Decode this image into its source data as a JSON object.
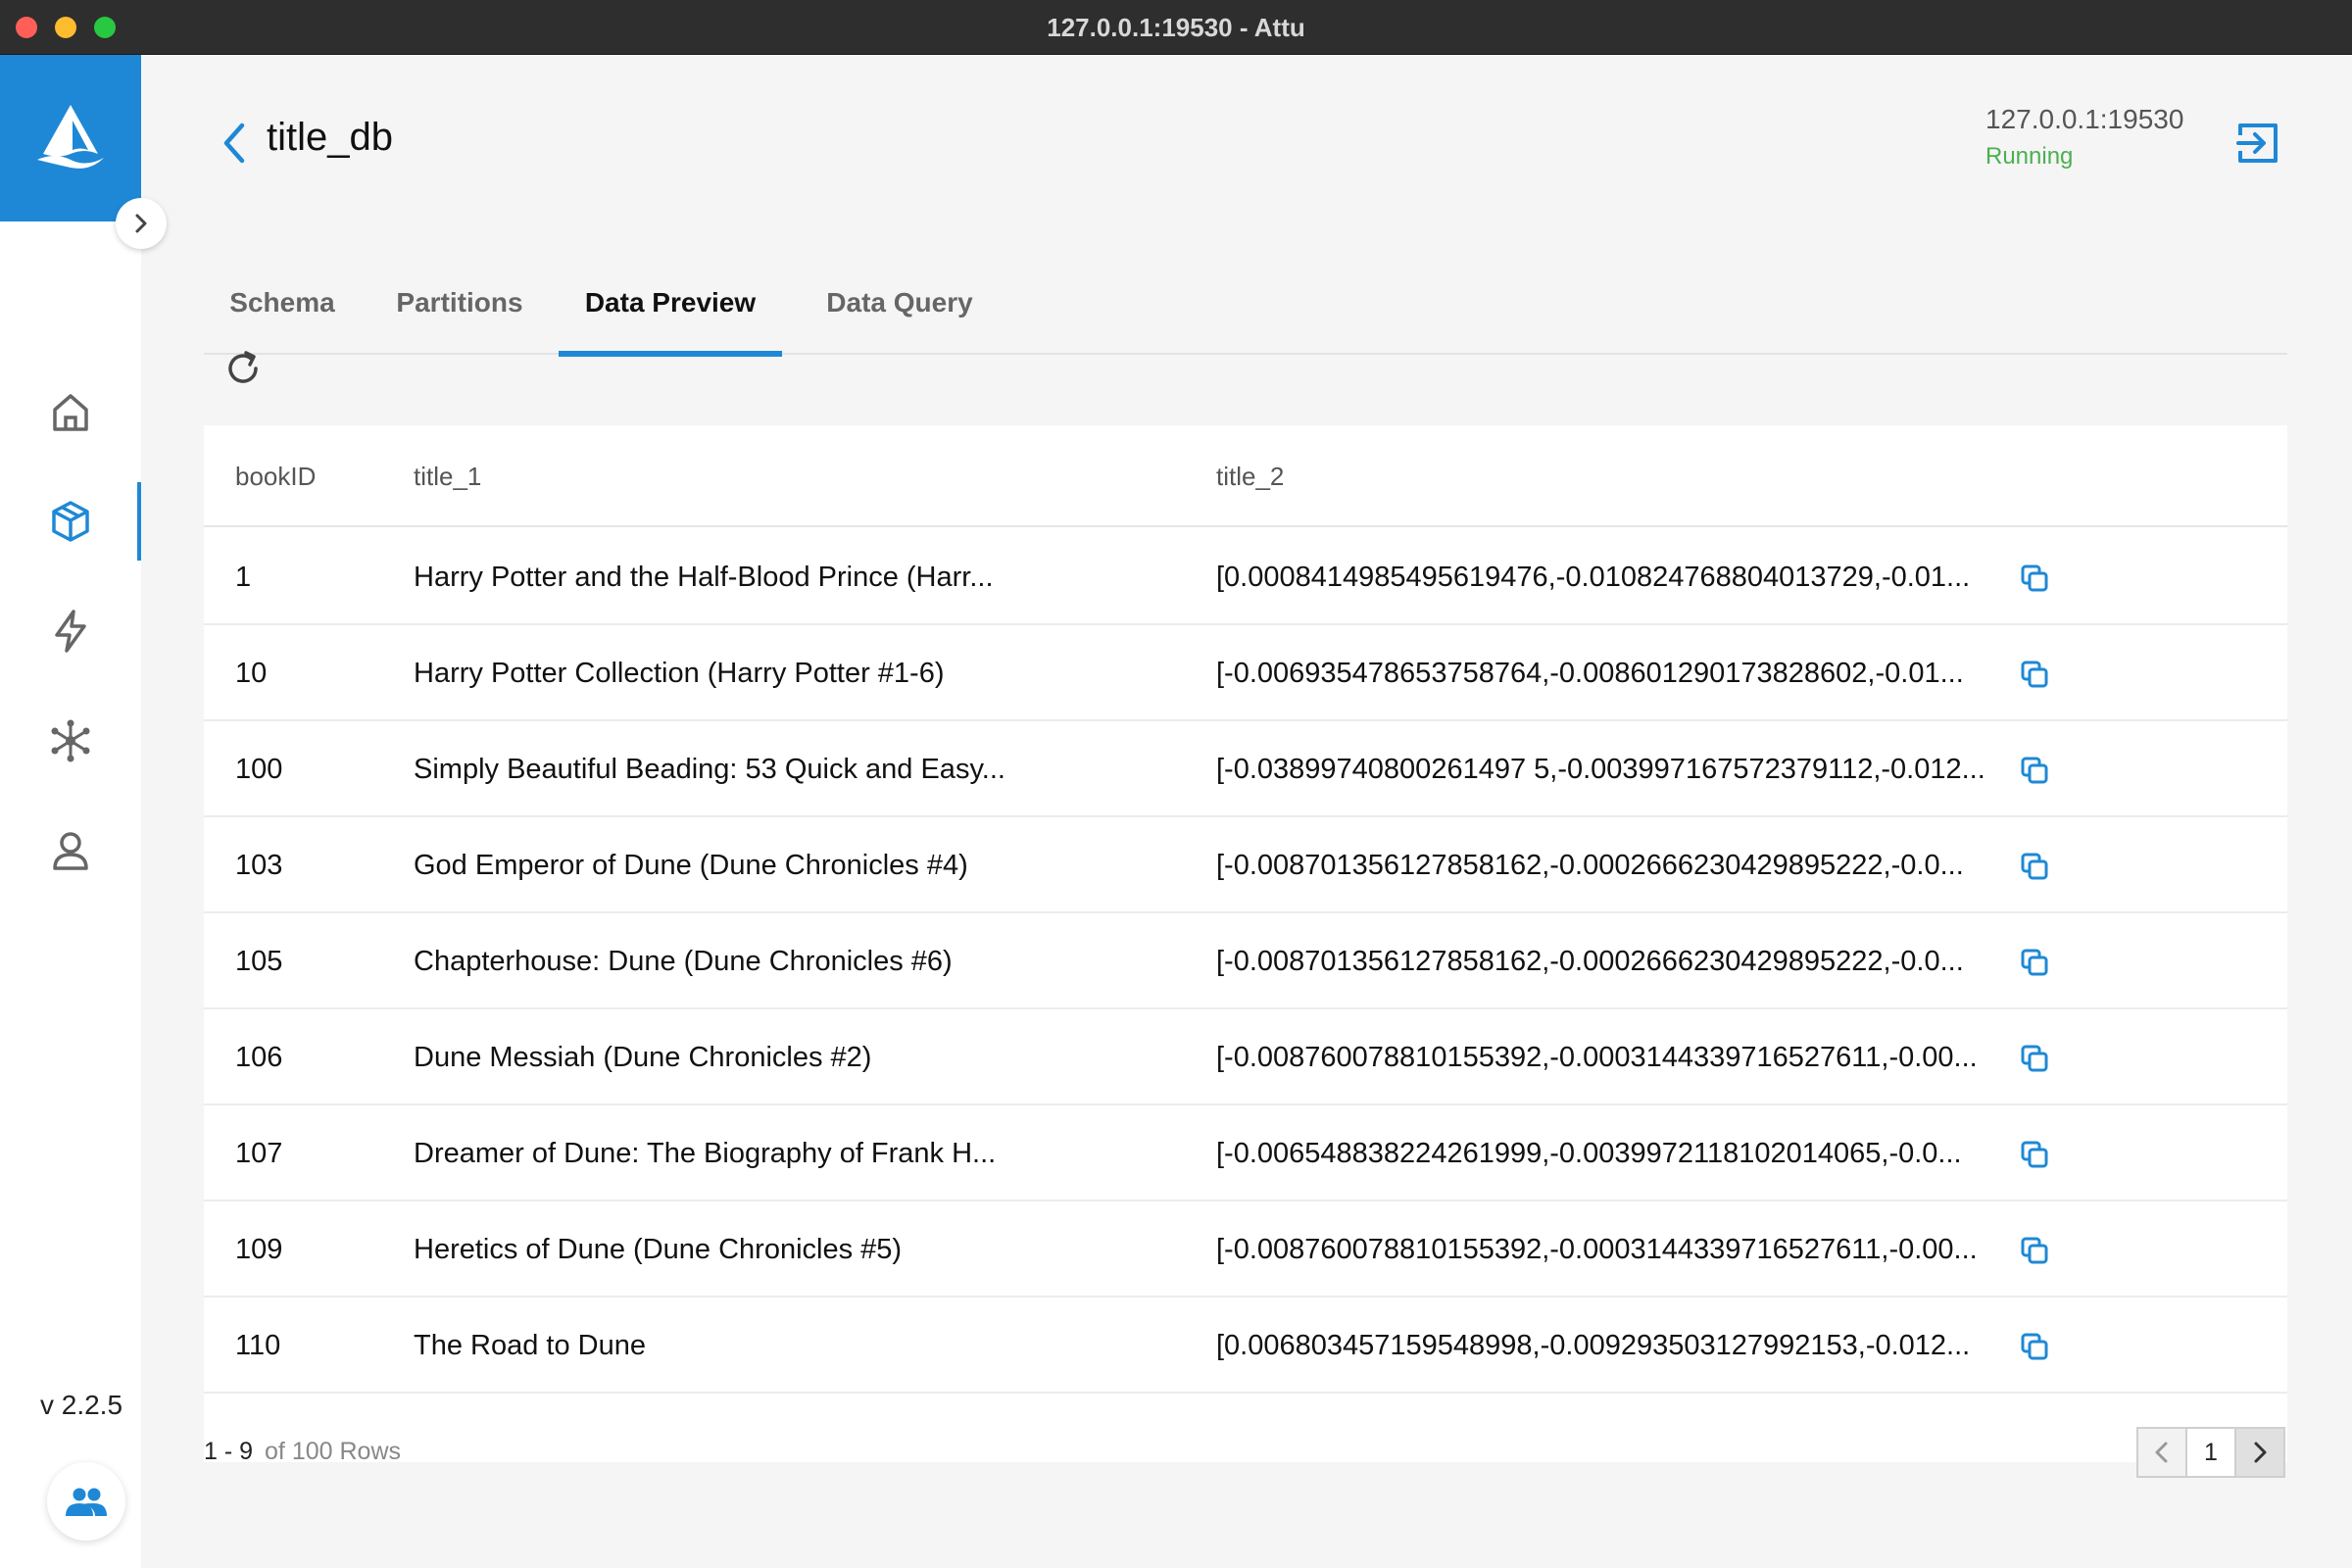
{
  "window": {
    "title": "127.0.0.1:19530 - Attu"
  },
  "sidebar": {
    "version": "v 2.2.5",
    "nav": [
      {
        "id": "home",
        "icon": "home-icon"
      },
      {
        "id": "collections",
        "icon": "cube-icon",
        "active": true
      },
      {
        "id": "search",
        "icon": "lightning-icon"
      },
      {
        "id": "system",
        "icon": "network-icon"
      },
      {
        "id": "users",
        "icon": "user-icon"
      }
    ]
  },
  "header": {
    "title": "title_db",
    "connection": {
      "address": "127.0.0.1:19530",
      "status": "Running"
    }
  },
  "tabs": [
    {
      "label": "Schema"
    },
    {
      "label": "Partitions"
    },
    {
      "label": "Data Preview",
      "active": true
    },
    {
      "label": "Data Query"
    }
  ],
  "table": {
    "columns": [
      "bookID",
      "title_1",
      "title_2"
    ],
    "rows": [
      {
        "bookID": "1",
        "title_1": "Harry Potter and the Half-Blood Prince (Harr...",
        "title_2": "[0.0008414985495619476,-0.010824768804013729,-0.01..."
      },
      {
        "bookID": "10",
        "title_1": "Harry Potter Collection (Harry Potter #1-6)",
        "title_2": "[-0.006935478653758764,-0.008601290173828602,-0.01..."
      },
      {
        "bookID": "100",
        "title_1": "Simply Beautiful Beading: 53 Quick and Easy...",
        "title_2": "[-0.03899740800261497 5,-0.003997167572379112,-0.012..."
      },
      {
        "bookID": "103",
        "title_1": "God Emperor of Dune (Dune Chronicles #4)",
        "title_2": "[-0.008701356127858162,-0.0002666230429895222,-0.0..."
      },
      {
        "bookID": "105",
        "title_1": "Chapterhouse: Dune (Dune Chronicles #6)",
        "title_2": "[-0.008701356127858162,-0.0002666230429895222,-0.0..."
      },
      {
        "bookID": "106",
        "title_1": "Dune Messiah (Dune Chronicles #2)",
        "title_2": "[-0.008760078810155392,-0.0003144339716527611,-0.00..."
      },
      {
        "bookID": "107",
        "title_1": "Dreamer of Dune: The Biography of Frank H...",
        "title_2": "[-0.006548838224261999,-0.0039972118102014065,-0.0..."
      },
      {
        "bookID": "109",
        "title_1": "Heretics of Dune (Dune Chronicles #5)",
        "title_2": "[-0.008760078810155392,-0.0003144339716527611,-0.00..."
      },
      {
        "bookID": "110",
        "title_1": "The Road to Dune",
        "title_2": "[0.006803457159548998,-0.009293503127992153,-0.012..."
      }
    ]
  },
  "footer": {
    "range": "1 - 9",
    "total": "of 100 Rows",
    "current_page": "1"
  },
  "colors": {
    "accent": "#1e88d6",
    "status_running": "#4caf50"
  }
}
